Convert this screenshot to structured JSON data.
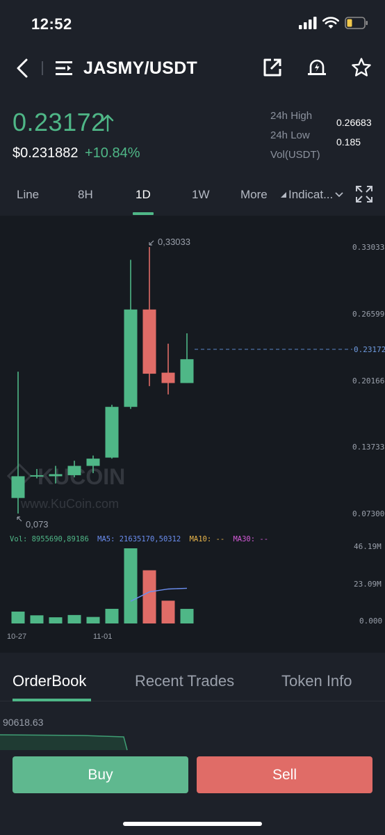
{
  "status": {
    "time": "12:52"
  },
  "nav": {
    "title": "JASMY/USDT"
  },
  "price": {
    "last": "0.23172",
    "fiat": "$0.231882",
    "change": "+10.84%",
    "stats": [
      {
        "label": "24h High",
        "value": "0.26683"
      },
      {
        "label": "24h Low",
        "value": "0.185"
      },
      {
        "label": "Vol(USDT)",
        "value": ""
      }
    ],
    "colors": {
      "up": "#4fb787",
      "down": "#e06c67"
    }
  },
  "timeframes": [
    "Line",
    "8H",
    "1D",
    "1W",
    "More",
    "Indicat..."
  ],
  "active_timeframe": "1D",
  "chart": {
    "watermark_brand": "KUCOIN",
    "watermark_url": "www.KuCoin.com",
    "high_marker": "0,33033",
    "low_marker": "0,073",
    "last_price_tag": "0.23172",
    "volume_legend": {
      "vol": "Vol: 8955690,89186",
      "ma5": "MA5: 21635170,50312",
      "ma10": "MA10: --",
      "ma30": "MA30: --"
    }
  },
  "chart_data": {
    "type": "candlestick",
    "price_axis_ticks": [
      "0.33033",
      "0.26599",
      "0.20166",
      "0.13733",
      "0.07300"
    ],
    "volume_axis_ticks": [
      "46.19M",
      "23.09M",
      "0.000"
    ],
    "x_tick_labels": [
      "10-27",
      "11-01"
    ],
    "ylim": [
      0.073,
      0.33033
    ],
    "candles": [
      {
        "open": 0.088,
        "high": 0.21,
        "low": 0.073,
        "close": 0.109,
        "volume": 7.3
      },
      {
        "open": 0.109,
        "high": 0.116,
        "low": 0.107,
        "close": 0.11,
        "volume": 5.0
      },
      {
        "open": 0.109,
        "high": 0.119,
        "low": 0.102,
        "close": 0.111,
        "volume": 3.8
      },
      {
        "open": 0.11,
        "high": 0.124,
        "low": 0.108,
        "close": 0.119,
        "volume": 5.2
      },
      {
        "open": 0.119,
        "high": 0.129,
        "low": 0.112,
        "close": 0.126,
        "volume": 4.0
      },
      {
        "open": 0.127,
        "high": 0.178,
        "low": 0.126,
        "close": 0.176,
        "volume": 9.0
      },
      {
        "open": 0.176,
        "high": 0.318,
        "low": 0.174,
        "close": 0.27,
        "volume": 46.2
      },
      {
        "open": 0.27,
        "high": 0.33033,
        "low": 0.196,
        "close": 0.208,
        "volume": 32.7
      },
      {
        "open": 0.209,
        "high": 0.237,
        "low": 0.188,
        "close": 0.199,
        "volume": 14.0
      },
      {
        "open": 0.199,
        "high": 0.247,
        "low": 0.199,
        "close": 0.222,
        "volume": 8.96
      }
    ],
    "ma5_line": [
      null,
      null,
      null,
      null,
      5.06,
      5.4,
      13.64,
      19.42,
      21.18,
      21.64
    ]
  },
  "bottom_tabs": [
    "OrderBook",
    "Recent Trades",
    "Token Info"
  ],
  "active_bottom_tab": "OrderBook",
  "depth_value": "90618.63",
  "actions": {
    "buy": "Buy",
    "sell": "Sell"
  }
}
